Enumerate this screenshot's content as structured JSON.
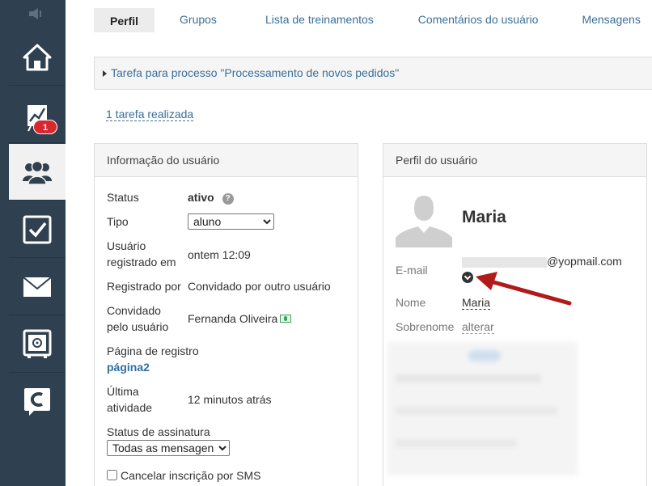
{
  "sidebar": {
    "items": [
      {
        "name": "home",
        "icon": "home-icon"
      },
      {
        "name": "dashboard",
        "icon": "chart-board-icon",
        "badge": "1"
      },
      {
        "name": "users",
        "icon": "users-icon",
        "active": true
      },
      {
        "name": "tasks",
        "icon": "checkbox-icon"
      },
      {
        "name": "messages",
        "icon": "envelope-icon"
      },
      {
        "name": "safe",
        "icon": "safe-icon"
      },
      {
        "name": "chat",
        "icon": "chat-c-icon"
      }
    ]
  },
  "tabs": [
    {
      "label": "Perfil",
      "active": true
    },
    {
      "label": "Grupos"
    },
    {
      "label": "Lista de treinamentos"
    },
    {
      "label": "Comentários do usuário"
    },
    {
      "label": "Mensagens"
    }
  ],
  "process": {
    "label": "Tarefa para processo \"Processamento de novos pedidos\""
  },
  "tasks_done": "1 tarefa realizada",
  "user_info": {
    "title": "Informação do usuário",
    "status_label": "Status",
    "status_value": "ativo",
    "type_label": "Tipo",
    "type_value": "aluno",
    "registered_label": "Usuário registrado em",
    "registered_value": "ontem 12:09",
    "registered_by_label": "Registrado por",
    "registered_by_value": "Convidado por outro usuário",
    "invited_by_label": "Convidado pelo usuário",
    "invited_by_value": "Fernanda Oliveira",
    "reg_page_label": "Página de registro",
    "reg_page_value": "página2",
    "last_activity_label": "Última atividade",
    "last_activity_value": "12 minutos atrás",
    "subscription_label": "Status de assinatura",
    "subscription_value": "Todas as mensagens",
    "sms_label": "Cancelar inscrição por SMS"
  },
  "user_profile": {
    "title": "Perfil do usuário",
    "name": "Maria",
    "email_label": "E-mail",
    "email_domain": "@yopmail.com",
    "first_name_label": "Nome",
    "first_name_value": "Maria",
    "last_name_label": "Sobrenome",
    "last_name_action": "alterar"
  },
  "colors": {
    "sidebar": "#2f4050",
    "link": "#3a6f9a",
    "badge": "#d9272e",
    "arrow": "#b01a1a"
  }
}
